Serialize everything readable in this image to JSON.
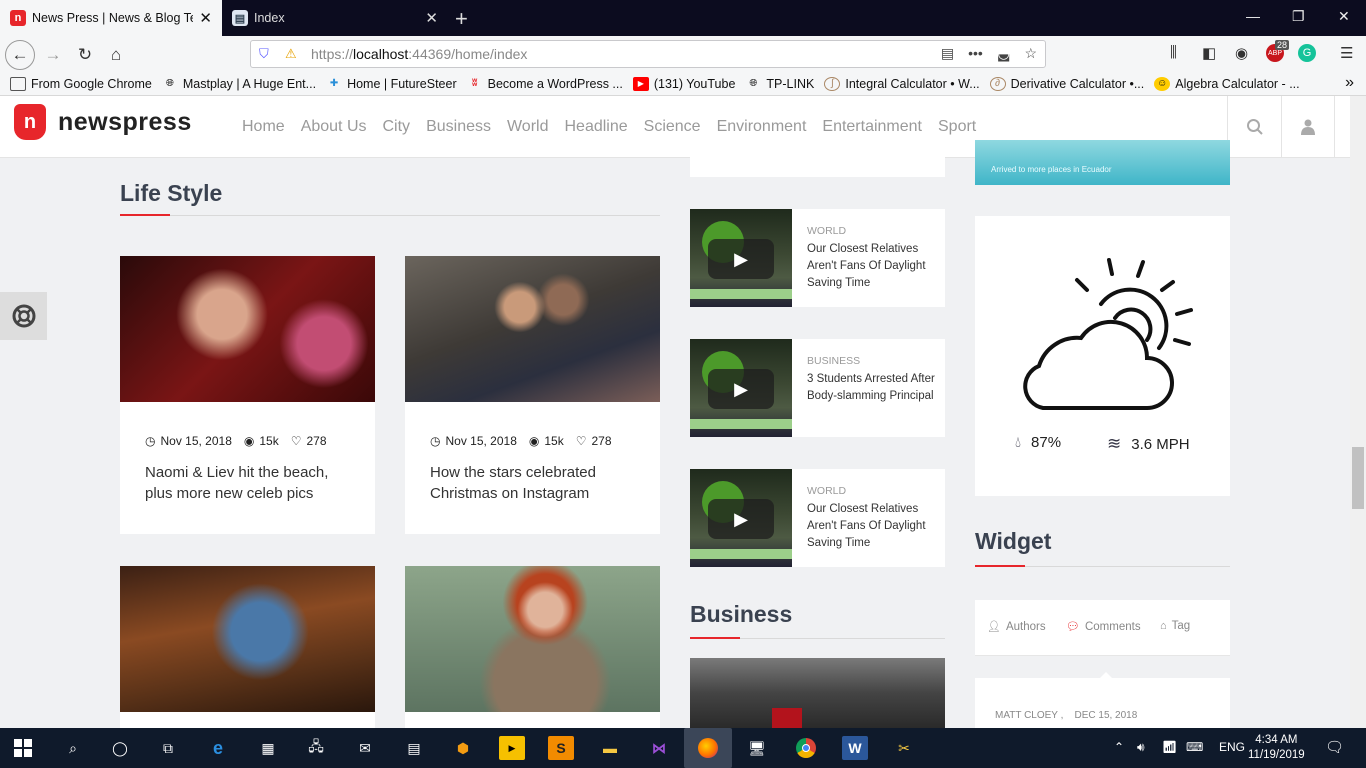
{
  "browser": {
    "tabs": [
      {
        "title": "News Press | News & Blog Temp",
        "favicon": "newspress-favicon",
        "active": true
      },
      {
        "title": "Index",
        "favicon": "page-favicon",
        "active": false
      }
    ],
    "url_prefix": "https://",
    "url_host": "localhost",
    "url_rest": ":44369/home/index",
    "badge_count": "28",
    "bookmarks": [
      {
        "label": "From Google Chrome",
        "icon": "folder-icon"
      },
      {
        "label": "Mastplay | A Huge Ent...",
        "icon": "globe-icon"
      },
      {
        "label": "Home | FutureSteer",
        "icon": "futuresteer-icon"
      },
      {
        "label": "Become a WordPress ...",
        "icon": "wordpress-icon"
      },
      {
        "label": "(131) YouTube",
        "icon": "youtube-icon"
      },
      {
        "label": "TP-LINK",
        "icon": "globe-icon"
      },
      {
        "label": "Integral Calculator • W...",
        "icon": "calculator-icon"
      },
      {
        "label": "Derivative Calculator •...",
        "icon": "calculator-icon"
      },
      {
        "label": "Algebra Calculator - ...",
        "icon": "algebra-icon"
      }
    ]
  },
  "site": {
    "brand": "newspress",
    "logo_letter": "n",
    "menu": [
      "Home",
      "About Us",
      "City",
      "Business",
      "World",
      "Headline",
      "Science",
      "Environment",
      "Entertainment",
      "Sport"
    ]
  },
  "lifestyle": {
    "title": "Life Style",
    "cards": [
      {
        "date": "Nov 15, 2018",
        "views": "15k",
        "likes": "278",
        "title": "Naomi & Liev hit the beach, plus more new celeb pics"
      },
      {
        "date": "Nov 15, 2018",
        "views": "15k",
        "likes": "278",
        "title": "How the stars celebrated Christmas on Instagram"
      }
    ]
  },
  "videos": [
    {
      "category": "WORLD",
      "title": "Our Closest Relatives Aren't Fans Of Daylight Saving Time"
    },
    {
      "category": "BUSINESS",
      "title": "3 Students Arrested After Body-slamming Principal"
    },
    {
      "category": "WORLD",
      "title": "Our Closest Relatives Aren't Fans Of Daylight Saving Time"
    }
  ],
  "business": {
    "title": "Business"
  },
  "ad": {
    "caption": "Arrived to more places in Ecuador"
  },
  "weather": {
    "humidity": "87%",
    "wind": "3.6 MPH"
  },
  "widget": {
    "title": "Widget",
    "tabs": [
      "Authors",
      "Comments",
      "Tag"
    ],
    "author": "MATT CLOEY ,",
    "date": "DEC 15, 2018"
  },
  "taskbar": {
    "time": "4:34 AM",
    "date": "11/19/2019",
    "lang": "ENG"
  },
  "colors": {
    "accent": "#e7262b",
    "heading": "#3a4250"
  }
}
